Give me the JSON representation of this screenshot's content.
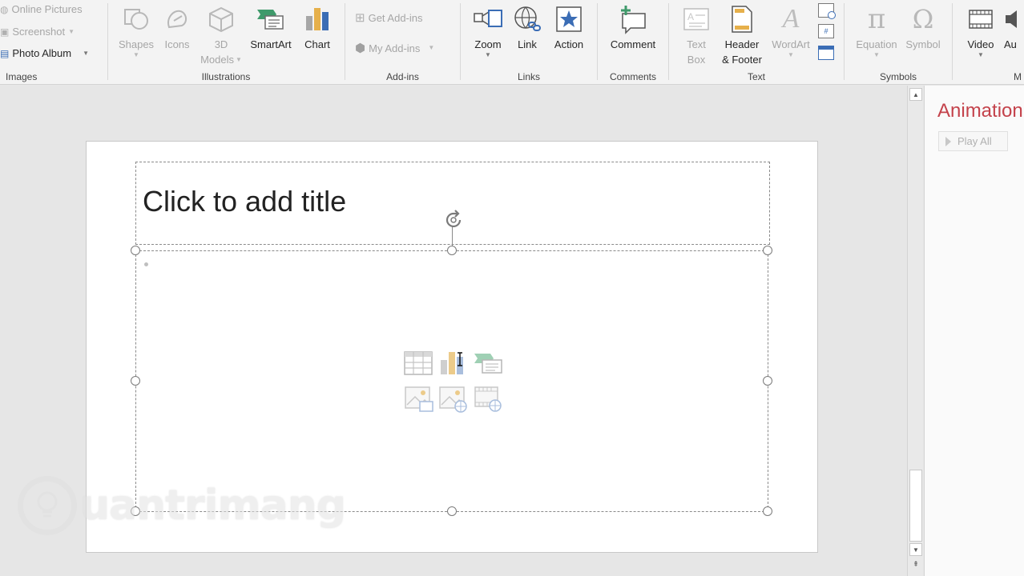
{
  "ribbon": {
    "images": {
      "label": "Images",
      "online_pictures": "Online Pictures",
      "screenshot": "Screenshot",
      "photo_album": "Photo Album"
    },
    "illustrations": {
      "label": "Illustrations",
      "shapes": "Shapes",
      "icons": "Icons",
      "models_line1": "3D",
      "models_line2": "Models",
      "smartart": "SmartArt",
      "chart": "Chart"
    },
    "addins": {
      "label": "Add-ins",
      "get_addins": "Get Add-ins",
      "my_addins": "My Add-ins"
    },
    "links": {
      "label": "Links",
      "zoom": "Zoom",
      "link": "Link",
      "action": "Action"
    },
    "comments": {
      "label": "Comments",
      "comment": "Comment"
    },
    "text": {
      "label": "Text",
      "textbox_line1": "Text",
      "textbox_line2": "Box",
      "header_line1": "Header",
      "header_line2": "& Footer",
      "wordart": "WordArt"
    },
    "symbols": {
      "label": "Symbols",
      "equation": "Equation",
      "symbol": "Symbol"
    },
    "media": {
      "label": "M",
      "video": "Video",
      "audio": "Au"
    }
  },
  "slide": {
    "title_placeholder": "Click to add title"
  },
  "animation_pane": {
    "title": "Animation",
    "play_all": "Play All"
  },
  "watermark": {
    "text": "uantrimang"
  },
  "colors": {
    "accent": "#c4424b",
    "ribbon_bg": "#f3f3f3",
    "workspace_bg": "#e6e6e6"
  }
}
